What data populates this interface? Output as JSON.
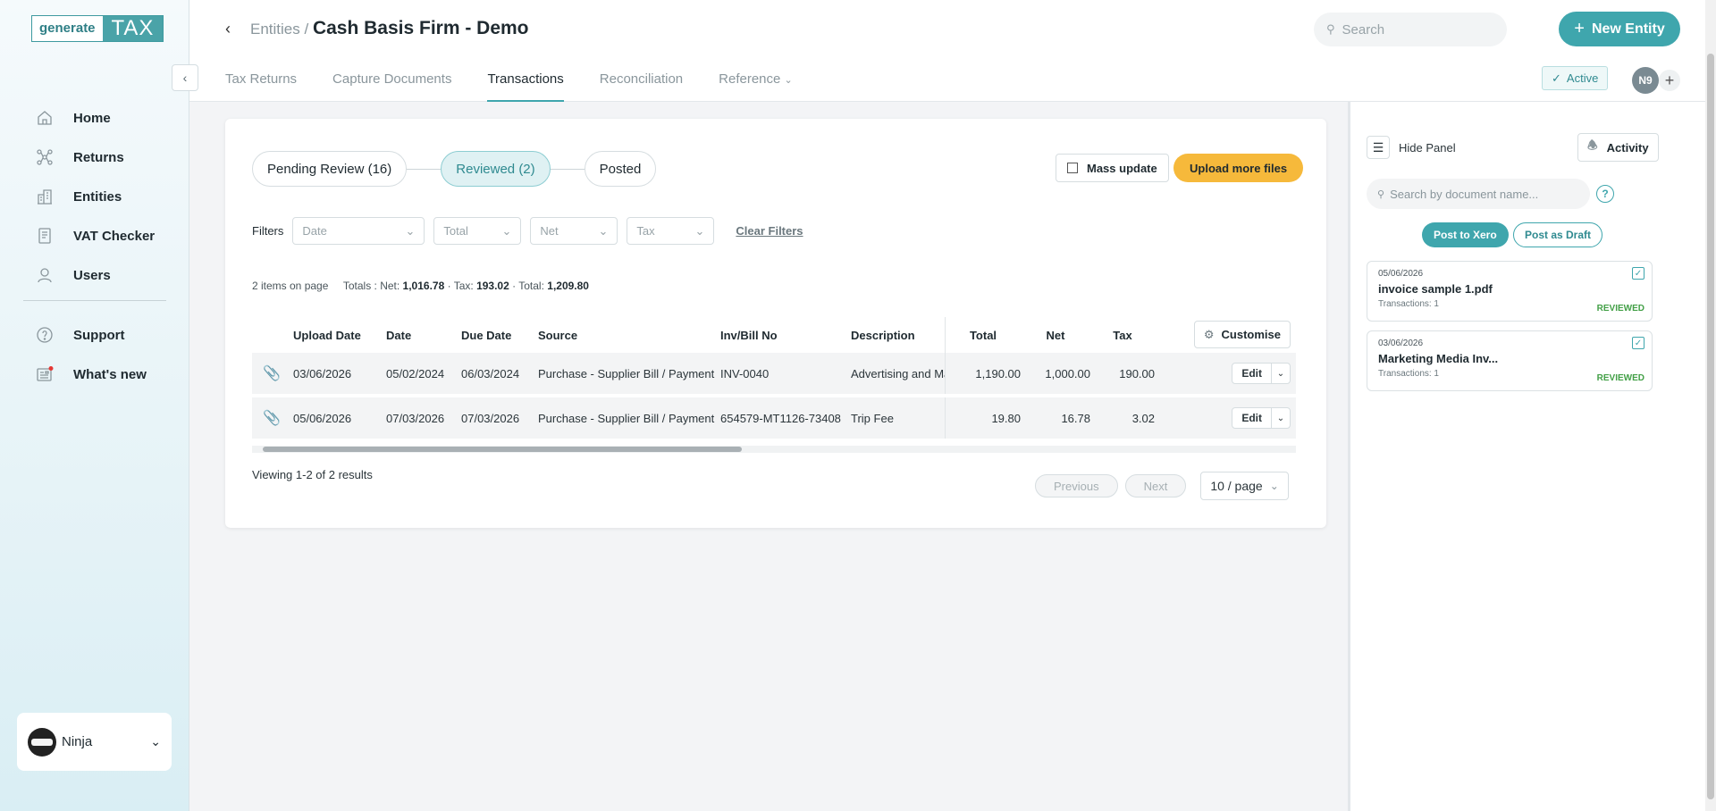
{
  "logo": {
    "part1": "generate",
    "part2": "TAX"
  },
  "sidebar": {
    "items": [
      {
        "label": "Home",
        "icon": "home-icon"
      },
      {
        "label": "Returns",
        "icon": "returns-icon"
      },
      {
        "label": "Entities",
        "icon": "building-icon"
      },
      {
        "label": "VAT Checker",
        "icon": "document-icon"
      },
      {
        "label": "Users",
        "icon": "user-icon"
      }
    ],
    "secondary": [
      {
        "label": "Support",
        "icon": "help-icon"
      },
      {
        "label": "What's new",
        "icon": "news-icon"
      }
    ],
    "user": {
      "name": "Ninja"
    }
  },
  "header": {
    "crumb_parent": "Entities /",
    "title": "Cash Basis Firm - Demo",
    "search_placeholder": "Search",
    "new_entity": "New Entity",
    "status": "Active",
    "user_initials": "N9",
    "tabs": [
      "Tax Returns",
      "Capture Documents",
      "Transactions",
      "Reconciliation",
      "Reference"
    ]
  },
  "main": {
    "pills": {
      "pending_label": "Pending Review",
      "pending_count": "(16)",
      "reviewed_label": "Reviewed",
      "reviewed_count": "(2)",
      "posted_label": "Posted"
    },
    "mass_update": "Mass update",
    "upload_more": "Upload more files",
    "filters_label": "Filters",
    "filters": [
      "Date",
      "Total",
      "Net",
      "Tax"
    ],
    "clear_filters": "Clear Filters",
    "totals": {
      "items": "2 items on page",
      "net_label": "Totals : Net:",
      "net": "1,016.78",
      "tax_label": "· Tax:",
      "tax": "193.02",
      "total_label": "· Total:",
      "total": "1,209.80"
    },
    "columns": [
      "Upload Date",
      "Date",
      "Due Date",
      "Source",
      "Inv/Bill No",
      "Description",
      "Total",
      "Net",
      "Tax"
    ],
    "customise": "Customise",
    "rows": [
      {
        "upload": "03/06/2026",
        "date": "05/02/2024",
        "due": "06/03/2024",
        "source": "Purchase - Supplier Bill / Payment",
        "inv": "INV-0040",
        "desc": "Advertising and Marketing",
        "total": "1,190.00",
        "net": "1,000.00",
        "tax": "190.00"
      },
      {
        "upload": "05/06/2026",
        "date": "07/03/2026",
        "due": "07/03/2026",
        "source": "Purchase - Supplier Bill / Payment",
        "inv": "654579-MT1126-73408",
        "desc": "Trip Fee",
        "total": "19.80",
        "net": "16.78",
        "tax": "3.02"
      }
    ],
    "edit_label": "Edit",
    "viewing": "Viewing 1-2 of 2 results",
    "previous": "Previous",
    "next": "Next",
    "per_page": "10 / page"
  },
  "panel": {
    "hide_panel": "Hide Panel",
    "activity": "Activity",
    "search_placeholder": "Search by document name...",
    "post_xero": "Post to Xero",
    "post_draft": "Post as Draft",
    "docs": [
      {
        "date": "05/06/2026",
        "name": "invoice sample 1.pdf",
        "tx": "Transactions: 1",
        "status": "REVIEWED"
      },
      {
        "date": "03/06/2026",
        "name": "Marketing Media Inv...",
        "tx": "Transactions: 1",
        "status": "REVIEWED"
      }
    ]
  },
  "colors": {
    "accent": "#3fa6ad",
    "upload": "#f6b93b",
    "reviewed": "#43a047"
  }
}
